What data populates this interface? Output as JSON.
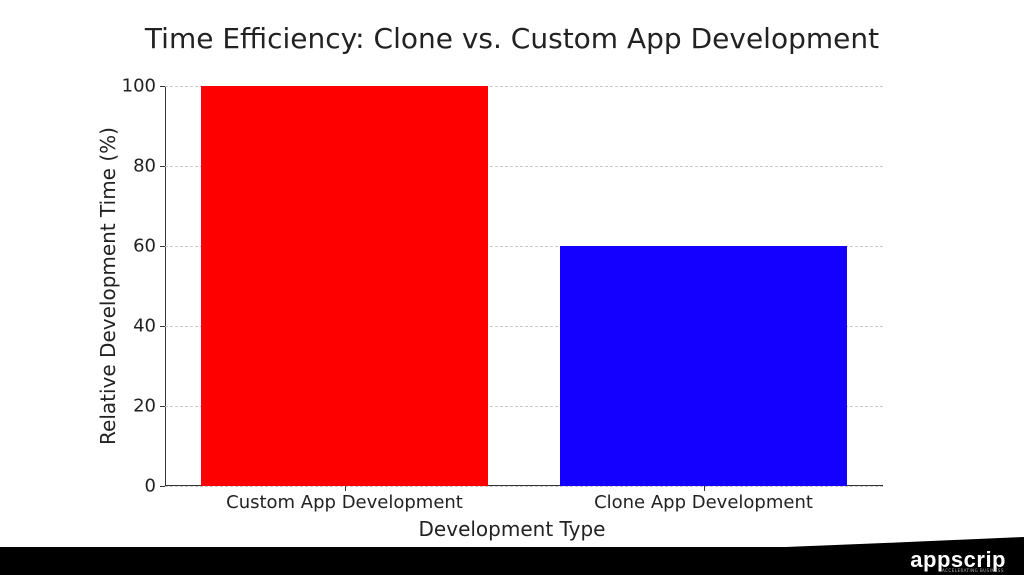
{
  "chart_data": {
    "type": "bar",
    "title": "Time Efficiency: Clone vs. Custom App Development",
    "xlabel": "Development Type",
    "ylabel": "Relative Development Time (%)",
    "categories": [
      "Custom App Development",
      "Clone App Development"
    ],
    "values": [
      100,
      60
    ],
    "colors": [
      "#ff0000",
      "#1400ff"
    ],
    "ylim": [
      0,
      100
    ],
    "yticks": [
      0,
      20,
      40,
      60,
      80,
      100
    ],
    "grid": true
  },
  "branding": {
    "name": "appscrip",
    "tagline": "ACCELERATING BUSINESS"
  }
}
